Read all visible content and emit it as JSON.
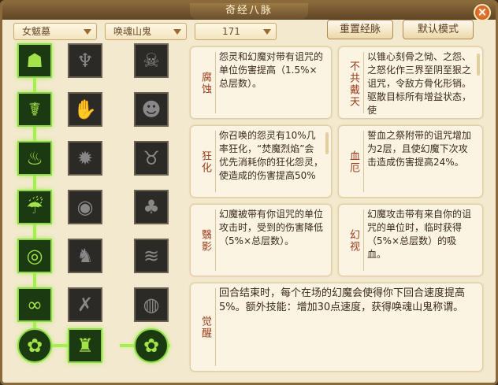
{
  "window": {
    "title": "奇经八脉"
  },
  "selectors": {
    "sect": "女魃墓",
    "character": "唤魂山鬼",
    "level": "171"
  },
  "buttons": {
    "reset": "重置经脉",
    "default_mode": "默认模式"
  },
  "talents": [
    {
      "name": "腐蚀",
      "desc": "怨灵和幻魔对带有诅咒的单位伤害提高（1.5%×总层数）。"
    },
    {
      "name": "不共戴天",
      "desc": "以锥心刻骨之恸、之怨、之怒化作三界至阴至狠之诅咒，令敌方骨化形销。驱散目标所有增益状态，使"
    },
    {
      "name": "狂化",
      "desc": "你召唤的怨灵有10%几率狂化，“焚魔烈焰”会优先消耗你的狂化怨灵，使造成的伤害提高50%"
    },
    {
      "name": "血厄",
      "desc": "誓血之祭附带的诅咒增加为2层，且使幻魔下次攻击造成伤害提高24%。"
    },
    {
      "name": "翳影",
      "desc": "幻魔被带有你诅咒的单位攻击时，受到的伤害降低（5%×总层数）。"
    },
    {
      "name": "幻视",
      "desc": "幻魔攻击带有来自你的诅咒的单位时，临时获得（5%×总层数）的吸血。"
    },
    {
      "name": "觉醒",
      "desc": "回合结束时，每个在场的幻魔会使得你下回合速度提高5%。额外技能：增加30点速度，获得唤魂山鬼称谓。"
    }
  ],
  "icons": [
    [
      "ghost-mask-icon",
      "fiend-face-icon",
      "demon-mask-icon"
    ],
    [
      "claw-icon",
      "grasp-hand-icon",
      "grin-mask-icon"
    ],
    [
      "flame-icon",
      "skull-burst-icon",
      "horned-face-icon"
    ],
    [
      "drip-icon",
      "eye-flame-icon",
      "fire-pillar-icon"
    ],
    [
      "eye-swirl-icon",
      "wraith-icon",
      "wave-icon"
    ],
    [
      "spiral-eyes-icon",
      "slash-icon",
      "vortex-icon"
    ],
    [
      "spiral-orb-icon",
      "hooded-spirit-icon",
      "spiral-orb-icon"
    ]
  ]
}
